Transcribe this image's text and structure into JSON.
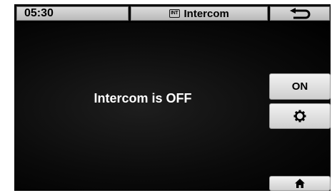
{
  "status_bar": {
    "time": "05:30",
    "title": "Intercom",
    "title_badge": "INT",
    "back_icon": "return-arrow-icon"
  },
  "main": {
    "status_message": "Intercom is OFF"
  },
  "side_buttons": {
    "on_label": "ON",
    "settings_icon": "gear-icon",
    "home_icon": "home-icon"
  }
}
